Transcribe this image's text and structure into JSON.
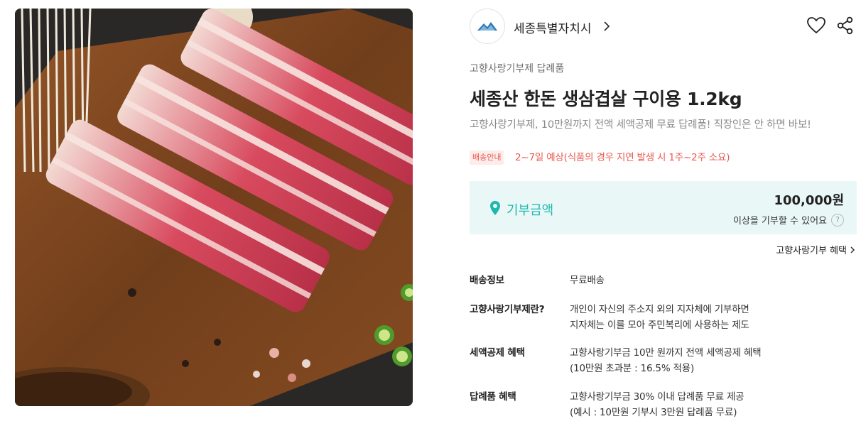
{
  "seller": {
    "name": "세종특별자치시",
    "logo_icon": "seojong-city-logo-icon",
    "chevron_icon": "chevron-right-icon"
  },
  "actions": {
    "like_icon": "heart-icon",
    "share_icon": "share-icon"
  },
  "product": {
    "category": "고향사랑기부제 답례품",
    "title": "세종산 한돈 생삼겹살 구이용 1.2kg",
    "subtitle": "고향사랑기부제, 10만원까지 전액 세액공제 무료 답례품! 직장인은 안 하면 바보!",
    "image_icon": "pork-belly-product-image"
  },
  "delivery": {
    "badge": "배송안내",
    "text": "2~7일 예상(식품의 경우 지연 발생 시 1주~2주 소요)"
  },
  "donation": {
    "label": "기부금액",
    "amount": "100,000원",
    "note": "이상을 기부할 수 있어요",
    "help": "?",
    "pin_icon": "location-pin-icon"
  },
  "benefit_link": "고향사랑기부 혜택",
  "info": [
    {
      "label": "배송정보",
      "lines": [
        "무료배송"
      ]
    },
    {
      "label": "고향사랑기부제란?",
      "lines": [
        "개인이 자신의 주소지 외의 지자체에 기부하면",
        "지자체는 이를 모아 주민복리에 사용하는 제도"
      ]
    },
    {
      "label": "세액공제 혜택",
      "lines": [
        "고향사랑기부금 10만 원까지 전액 세액공제 혜택",
        "(10만원 초과분 : 16.5% 적용)"
      ]
    },
    {
      "label": "답례품 혜택",
      "lines": [
        "고향사랑기부금 30% 이내 답례품 무료 제공",
        "(예시 : 10만원 기부시 3만원 답례품 무료)"
      ]
    }
  ],
  "colors": {
    "accent": "#1fb8ad",
    "accent_bg": "#e9f8f7",
    "warning": "#e85a4f",
    "warning_bg": "#fdecea"
  }
}
